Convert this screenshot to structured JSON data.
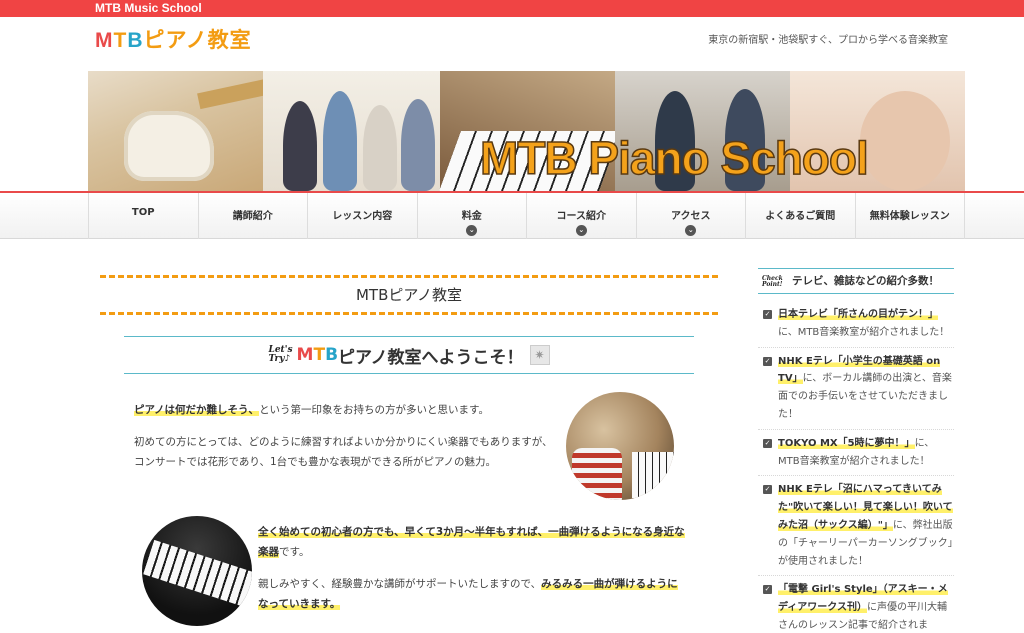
{
  "topbar": {
    "brand": "MTB Music School"
  },
  "header": {
    "logo_m": "M",
    "logo_t": "T",
    "logo_b": "B",
    "logo_rest": "ピアノ教室",
    "tagline": "東京の新宿駅・池袋駅すぐ、プロから学べる音楽教室"
  },
  "banner": {
    "text": "MTB Piano School"
  },
  "nav": {
    "items": [
      {
        "label": "TOP"
      },
      {
        "label": "講師紹介"
      },
      {
        "label": "レッスン内容"
      },
      {
        "label": "料金"
      },
      {
        "label": "コース紹介"
      },
      {
        "label": "アクセス"
      },
      {
        "label": "よくあるご質問"
      },
      {
        "label": "無料体験レッスン"
      }
    ],
    "dropdown_glyph": "⌄"
  },
  "main": {
    "page_title": "MTBピアノ教室",
    "welcome_lets": "Let's",
    "welcome_try": "Try♪",
    "welcome_m": "M",
    "welcome_t": "T",
    "welcome_b": "B",
    "welcome_rest": "ピアノ教室へようこそ！",
    "welcome_star": "✷",
    "p1_hl": "ピアノは何だか難しそう、",
    "p1_rest": "という第一印象をお持ちの方が多いと思います。",
    "p2": "初めての方にとっては、どのように練習すればよいか分かりにくい楽器でもありますが、コンサートでは花形であり、1台でも豊かな表現ができる所がピアノの魅力。",
    "p3_hl": "全く始めての初心者の方でも、早くて3か月〜半年もすれば、一曲弾けるようになる身近な楽器",
    "p3_rest": "です。",
    "p4_pre": "親しみやすく、経験豊かな講師がサポートいたしますので、",
    "p4_hl": "みるみる一曲が弾けるようになっていきます。"
  },
  "sidebar": {
    "head_check": "Check",
    "head_point": "Point!",
    "head_title": "テレビ、雑誌などの紹介多数！",
    "checkbox_glyph": "✓",
    "news": [
      {
        "hl": "日本テレビ「所さんの目がテン！」",
        "rest": "に、MTB音楽教室が紹介されました！"
      },
      {
        "hl": "NHK Eテレ「小学生の基礎英語 on TV」",
        "rest": "に、ボーカル講師の出演と、音楽面でのお手伝いをさせていただきました！"
      },
      {
        "hl": "TOKYO MX「5時に夢中！」",
        "rest": "に、MTB音楽教室が紹介されました！"
      },
      {
        "hl": "NHK Eテレ「沼にハマってきいてみた\"吹いて楽しい！見て楽しい！吹いてみた沼（サックス編）\"」",
        "rest": "に、弊社出版の「チャーリーパーカーソングブック」が使用されました！"
      },
      {
        "hl": "「電撃 Girl's Style」（アスキー・メディアワークス刊）",
        "rest": "に声優の平川大輔さんのレッスン記事で紹介されま"
      }
    ]
  }
}
